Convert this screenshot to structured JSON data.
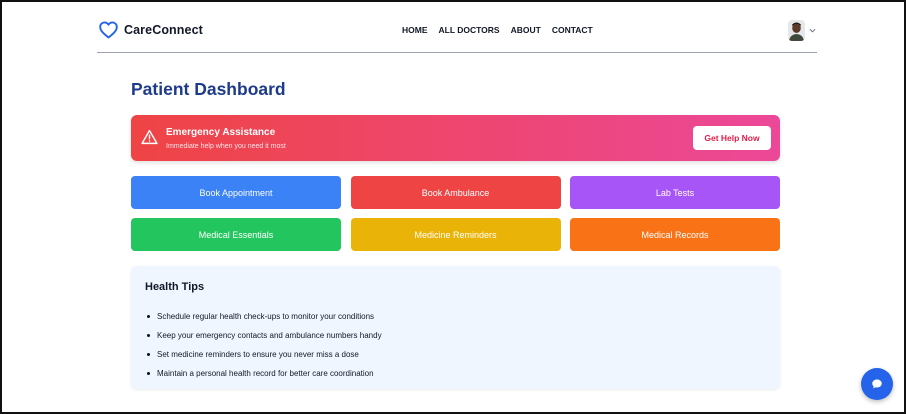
{
  "header": {
    "brand": "CareConnect",
    "nav": [
      "HOME",
      "ALL DOCTORS",
      "ABOUT",
      "CONTACT"
    ]
  },
  "page": {
    "title": "Patient Dashboard"
  },
  "emergency": {
    "title": "Emergency Assistance",
    "subtitle": "Immediate help when you need it most",
    "button": "Get Help Now"
  },
  "actions": [
    {
      "label": "Book Appointment",
      "color": "#3b82f6"
    },
    {
      "label": "Book Ambulance",
      "color": "#ef4444"
    },
    {
      "label": "Lab Tests",
      "color": "#a855f7"
    },
    {
      "label": "Medical Essentials",
      "color": "#22c55e"
    },
    {
      "label": "Medicine Reminders",
      "color": "#eab308"
    },
    {
      "label": "Medical Records",
      "color": "#f97316"
    }
  ],
  "tips": {
    "title": "Health Tips",
    "items": [
      "Schedule regular health check-ups to monitor your conditions",
      "Keep your emergency contacts and ambulance numbers handy",
      "Set medicine reminders to ensure you never miss a dose",
      "Maintain a personal health record for better care coordination"
    ]
  },
  "icons": {
    "brand": "heart-icon",
    "emergency": "warning-triangle-icon",
    "profile_menu": "chevron-down-icon",
    "chat": "chat-bubble-icon"
  },
  "colors": {
    "brand": "#2563eb",
    "title": "#1e3a8a",
    "emergency_start": "#ef4444",
    "emergency_end": "#ec4899",
    "tips_bg": "#eff6ff"
  }
}
